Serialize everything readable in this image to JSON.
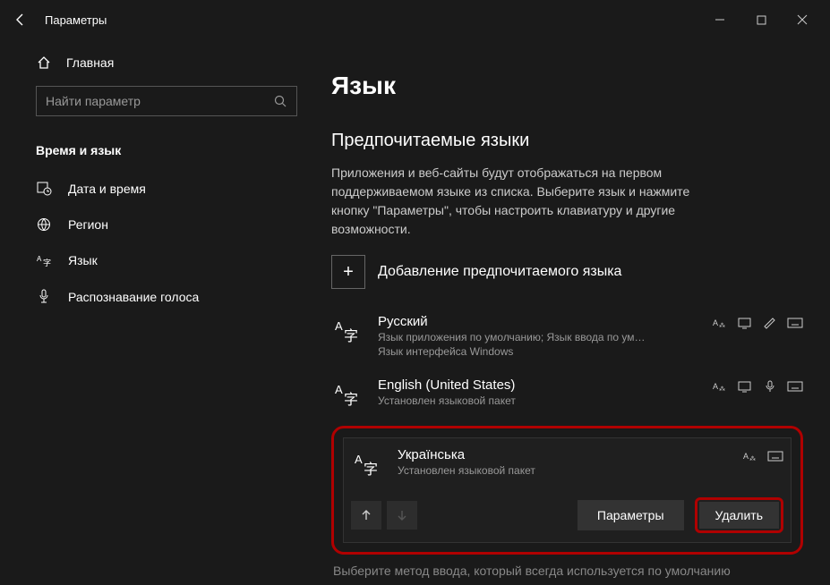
{
  "app": {
    "title": "Параметры"
  },
  "search": {
    "placeholder": "Найти параметр"
  },
  "home_label": "Главная",
  "section": "Время и язык",
  "nav": [
    {
      "label": "Дата и время"
    },
    {
      "label": "Регион"
    },
    {
      "label": "Язык"
    },
    {
      "label": "Распознавание голоса"
    }
  ],
  "page": {
    "title": "Язык",
    "subtitle": "Предпочитаемые языки",
    "description": "Приложения и веб-сайты будут отображаться на первом поддерживаемом языке из списка. Выберите язык и нажмите кнопку \"Параметры\", чтобы настроить клавиатуру и другие возможности.",
    "add_label": "Добавление предпочитаемого языка",
    "languages": [
      {
        "name": "Русский",
        "meta1": "Язык приложения по умолчанию; Язык ввода по умолчан…",
        "meta2": "Язык интерфейса Windows"
      },
      {
        "name": "English (United States)",
        "meta1": "Установлен языковой пакет"
      },
      {
        "name": "Українська",
        "meta1": "Установлен языковой пакет"
      }
    ],
    "btn_options": "Параметры",
    "btn_delete": "Удалить",
    "footer": "Выберите метод ввода, который всегда используется по умолчанию"
  }
}
